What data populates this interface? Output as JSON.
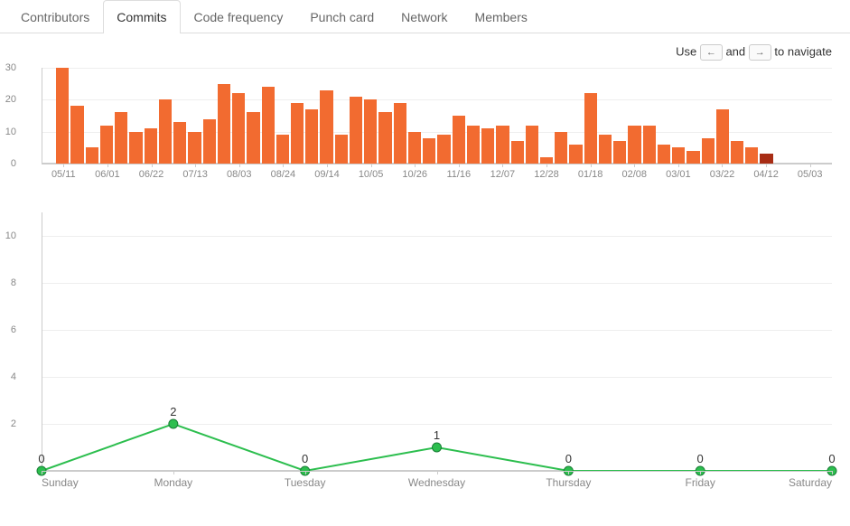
{
  "tabs": {
    "contributors": "Contributors",
    "commits": "Commits",
    "code_frequency": "Code frequency",
    "punch_card": "Punch card",
    "network": "Network",
    "members": "Members"
  },
  "nav_hint": {
    "use": "Use",
    "and": "and",
    "to_navigate": "to navigate",
    "left": "←",
    "right": "→"
  },
  "chart_data": [
    {
      "type": "bar",
      "title": "",
      "xlabel": "",
      "ylabel": "",
      "ylim": [
        0,
        30
      ],
      "yticks": [
        0,
        10,
        20,
        30
      ],
      "x_tick_labels": [
        "05/11",
        "06/01",
        "06/22",
        "07/13",
        "08/03",
        "08/24",
        "09/14",
        "10/05",
        "10/26",
        "11/16",
        "12/07",
        "12/28",
        "01/18",
        "02/08",
        "03/01",
        "03/22",
        "04/12",
        "05/03"
      ],
      "categories": [
        "05/04",
        "05/11",
        "05/18",
        "05/25",
        "06/01",
        "06/08",
        "06/15",
        "06/22",
        "06/29",
        "07/06",
        "07/13",
        "07/20",
        "07/27",
        "08/03",
        "08/10",
        "08/17",
        "08/24",
        "08/31",
        "09/07",
        "09/14",
        "09/21",
        "09/28",
        "10/05",
        "10/12",
        "10/19",
        "10/26",
        "11/02",
        "11/09",
        "11/16",
        "11/23",
        "11/30",
        "12/07",
        "12/14",
        "12/21",
        "12/28",
        "01/04",
        "01/11",
        "01/18",
        "01/25",
        "02/01",
        "02/08",
        "02/15",
        "02/22",
        "03/01",
        "03/08",
        "03/15",
        "03/22",
        "03/29",
        "04/05",
        "04/12",
        "04/19",
        "04/26",
        "05/03",
        "05/10"
      ],
      "values": [
        0,
        30,
        18,
        5,
        12,
        16,
        10,
        11,
        20,
        13,
        10,
        14,
        25,
        22,
        16,
        24,
        9,
        19,
        17,
        23,
        9,
        21,
        20,
        16,
        19,
        10,
        8,
        9,
        15,
        12,
        11,
        12,
        7,
        12,
        2,
        10,
        6,
        22,
        9,
        7,
        12,
        12,
        6,
        5,
        4,
        8,
        17,
        7,
        5,
        3,
        0,
        0,
        0,
        0
      ],
      "current_index": 49
    },
    {
      "type": "line",
      "title": "",
      "xlabel": "",
      "ylabel": "",
      "ylim": [
        0,
        11
      ],
      "yticks": [
        2,
        4,
        6,
        8,
        10
      ],
      "categories": [
        "Sunday",
        "Monday",
        "Tuesday",
        "Wednesday",
        "Thursday",
        "Friday",
        "Saturday"
      ],
      "values": [
        0,
        2,
        0,
        1,
        0,
        0,
        0
      ],
      "color": "#2cbe4e"
    }
  ]
}
